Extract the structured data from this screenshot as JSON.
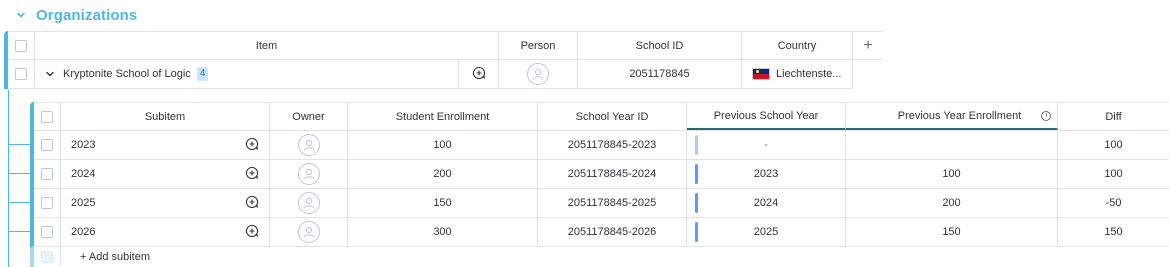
{
  "group": {
    "title": "Organizations",
    "color": "#4db8e8"
  },
  "main_table": {
    "headers": {
      "item": "Item",
      "person": "Person",
      "school_id": "School ID",
      "country": "Country",
      "add_column": "+"
    },
    "row": {
      "name": "Kryptonite School of Logic",
      "subitem_count": "4",
      "school_id": "2051178845",
      "country": "Liechtenste..."
    }
  },
  "sub_table": {
    "headers": {
      "subitem": "Subitem",
      "owner": "Owner",
      "student_enrollment": "Student Enrollment",
      "school_year_id": "School Year ID",
      "previous_school_year": "Previous School Year",
      "previous_year_enrollment": "Previous Year Enrollment",
      "info": "i",
      "diff": "Diff"
    },
    "rows": [
      {
        "name": "2023",
        "enrollment": "100",
        "school_year_id": "2051178845-2023",
        "prev_year": "-",
        "prev_enrollment": "",
        "diff": "100"
      },
      {
        "name": "2024",
        "enrollment": "200",
        "school_year_id": "2051178845-2024",
        "prev_year": "2023",
        "prev_enrollment": "100",
        "diff": "100"
      },
      {
        "name": "2025",
        "enrollment": "150",
        "school_year_id": "2051178845-2025",
        "prev_year": "2024",
        "prev_enrollment": "200",
        "diff": "-50"
      },
      {
        "name": "2026",
        "enrollment": "300",
        "school_year_id": "2051178845-2026",
        "prev_year": "2025",
        "prev_enrollment": "150",
        "diff": "150"
      }
    ],
    "add_subitem": "+ Add subitem"
  }
}
